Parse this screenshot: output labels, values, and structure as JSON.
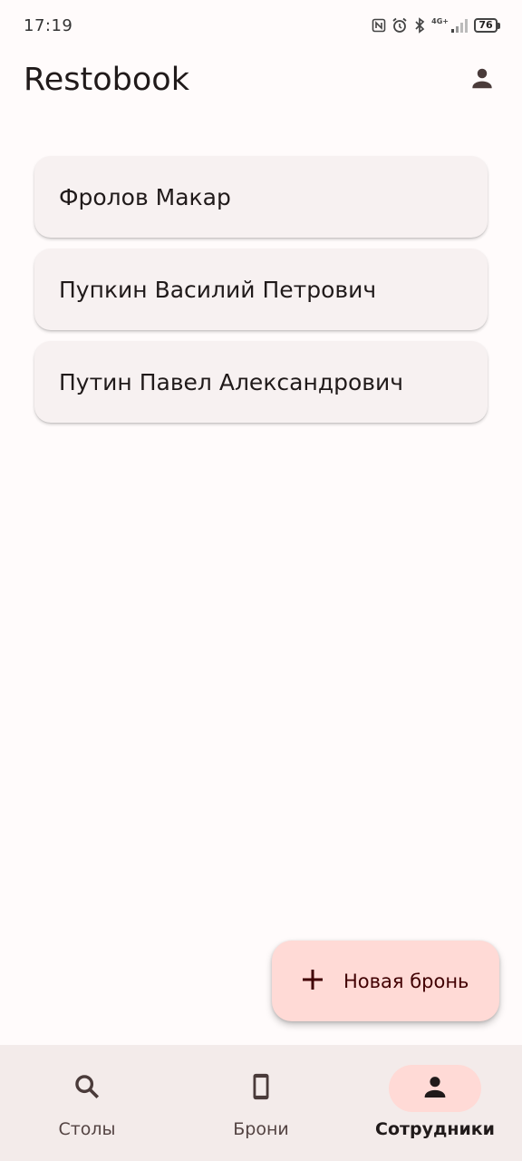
{
  "status_bar": {
    "time": "17:19",
    "battery": "76",
    "network": "4G+",
    "icons": [
      "nfc-icon",
      "alarm-icon",
      "bluetooth-icon",
      "signal-icon",
      "battery-icon"
    ]
  },
  "app_bar": {
    "title": "Restobook",
    "account_icon": "person-icon"
  },
  "employees": [
    {
      "name": "Фролов Макар"
    },
    {
      "name": "Пупкин Василий Петрович"
    },
    {
      "name": "Путин Павел Александрович"
    }
  ],
  "fab": {
    "icon": "plus-icon",
    "label": "Новая бронь"
  },
  "bottom_nav": {
    "items": [
      {
        "label": "Столы",
        "icon": "search-icon",
        "active": false
      },
      {
        "label": "Брони",
        "icon": "phone-icon",
        "active": false
      },
      {
        "label": "Сотрудники",
        "icon": "person-icon",
        "active": true
      }
    ]
  },
  "colors": {
    "background": "#fffbfb",
    "card": "#f7f1f1",
    "fab": "#ffdad6",
    "nav_background": "#f3ebea",
    "nav_active_pill": "#ffdad6",
    "text": "#201a1a"
  }
}
